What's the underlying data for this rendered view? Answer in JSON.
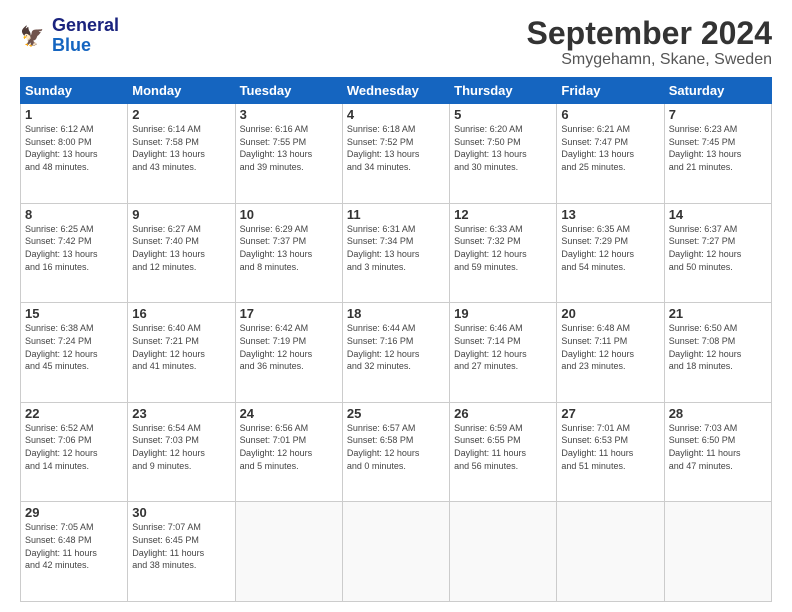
{
  "header": {
    "logo_line1": "General",
    "logo_line2": "Blue",
    "month": "September 2024",
    "location": "Smygehamn, Skane, Sweden"
  },
  "days_of_week": [
    "Sunday",
    "Monday",
    "Tuesday",
    "Wednesday",
    "Thursday",
    "Friday",
    "Saturday"
  ],
  "weeks": [
    [
      {
        "day": "1",
        "detail": "Sunrise: 6:12 AM\nSunset: 8:00 PM\nDaylight: 13 hours\nand 48 minutes."
      },
      {
        "day": "2",
        "detail": "Sunrise: 6:14 AM\nSunset: 7:58 PM\nDaylight: 13 hours\nand 43 minutes."
      },
      {
        "day": "3",
        "detail": "Sunrise: 6:16 AM\nSunset: 7:55 PM\nDaylight: 13 hours\nand 39 minutes."
      },
      {
        "day": "4",
        "detail": "Sunrise: 6:18 AM\nSunset: 7:52 PM\nDaylight: 13 hours\nand 34 minutes."
      },
      {
        "day": "5",
        "detail": "Sunrise: 6:20 AM\nSunset: 7:50 PM\nDaylight: 13 hours\nand 30 minutes."
      },
      {
        "day": "6",
        "detail": "Sunrise: 6:21 AM\nSunset: 7:47 PM\nDaylight: 13 hours\nand 25 minutes."
      },
      {
        "day": "7",
        "detail": "Sunrise: 6:23 AM\nSunset: 7:45 PM\nDaylight: 13 hours\nand 21 minutes."
      }
    ],
    [
      {
        "day": "8",
        "detail": "Sunrise: 6:25 AM\nSunset: 7:42 PM\nDaylight: 13 hours\nand 16 minutes."
      },
      {
        "day": "9",
        "detail": "Sunrise: 6:27 AM\nSunset: 7:40 PM\nDaylight: 13 hours\nand 12 minutes."
      },
      {
        "day": "10",
        "detail": "Sunrise: 6:29 AM\nSunset: 7:37 PM\nDaylight: 13 hours\nand 8 minutes."
      },
      {
        "day": "11",
        "detail": "Sunrise: 6:31 AM\nSunset: 7:34 PM\nDaylight: 13 hours\nand 3 minutes."
      },
      {
        "day": "12",
        "detail": "Sunrise: 6:33 AM\nSunset: 7:32 PM\nDaylight: 12 hours\nand 59 minutes."
      },
      {
        "day": "13",
        "detail": "Sunrise: 6:35 AM\nSunset: 7:29 PM\nDaylight: 12 hours\nand 54 minutes."
      },
      {
        "day": "14",
        "detail": "Sunrise: 6:37 AM\nSunset: 7:27 PM\nDaylight: 12 hours\nand 50 minutes."
      }
    ],
    [
      {
        "day": "15",
        "detail": "Sunrise: 6:38 AM\nSunset: 7:24 PM\nDaylight: 12 hours\nand 45 minutes."
      },
      {
        "day": "16",
        "detail": "Sunrise: 6:40 AM\nSunset: 7:21 PM\nDaylight: 12 hours\nand 41 minutes."
      },
      {
        "day": "17",
        "detail": "Sunrise: 6:42 AM\nSunset: 7:19 PM\nDaylight: 12 hours\nand 36 minutes."
      },
      {
        "day": "18",
        "detail": "Sunrise: 6:44 AM\nSunset: 7:16 PM\nDaylight: 12 hours\nand 32 minutes."
      },
      {
        "day": "19",
        "detail": "Sunrise: 6:46 AM\nSunset: 7:14 PM\nDaylight: 12 hours\nand 27 minutes."
      },
      {
        "day": "20",
        "detail": "Sunrise: 6:48 AM\nSunset: 7:11 PM\nDaylight: 12 hours\nand 23 minutes."
      },
      {
        "day": "21",
        "detail": "Sunrise: 6:50 AM\nSunset: 7:08 PM\nDaylight: 12 hours\nand 18 minutes."
      }
    ],
    [
      {
        "day": "22",
        "detail": "Sunrise: 6:52 AM\nSunset: 7:06 PM\nDaylight: 12 hours\nand 14 minutes."
      },
      {
        "day": "23",
        "detail": "Sunrise: 6:54 AM\nSunset: 7:03 PM\nDaylight: 12 hours\nand 9 minutes."
      },
      {
        "day": "24",
        "detail": "Sunrise: 6:56 AM\nSunset: 7:01 PM\nDaylight: 12 hours\nand 5 minutes."
      },
      {
        "day": "25",
        "detail": "Sunrise: 6:57 AM\nSunset: 6:58 PM\nDaylight: 12 hours\nand 0 minutes."
      },
      {
        "day": "26",
        "detail": "Sunrise: 6:59 AM\nSunset: 6:55 PM\nDaylight: 11 hours\nand 56 minutes."
      },
      {
        "day": "27",
        "detail": "Sunrise: 7:01 AM\nSunset: 6:53 PM\nDaylight: 11 hours\nand 51 minutes."
      },
      {
        "day": "28",
        "detail": "Sunrise: 7:03 AM\nSunset: 6:50 PM\nDaylight: 11 hours\nand 47 minutes."
      }
    ],
    [
      {
        "day": "29",
        "detail": "Sunrise: 7:05 AM\nSunset: 6:48 PM\nDaylight: 11 hours\nand 42 minutes."
      },
      {
        "day": "30",
        "detail": "Sunrise: 7:07 AM\nSunset: 6:45 PM\nDaylight: 11 hours\nand 38 minutes."
      },
      {
        "day": "",
        "detail": ""
      },
      {
        "day": "",
        "detail": ""
      },
      {
        "day": "",
        "detail": ""
      },
      {
        "day": "",
        "detail": ""
      },
      {
        "day": "",
        "detail": ""
      }
    ]
  ]
}
